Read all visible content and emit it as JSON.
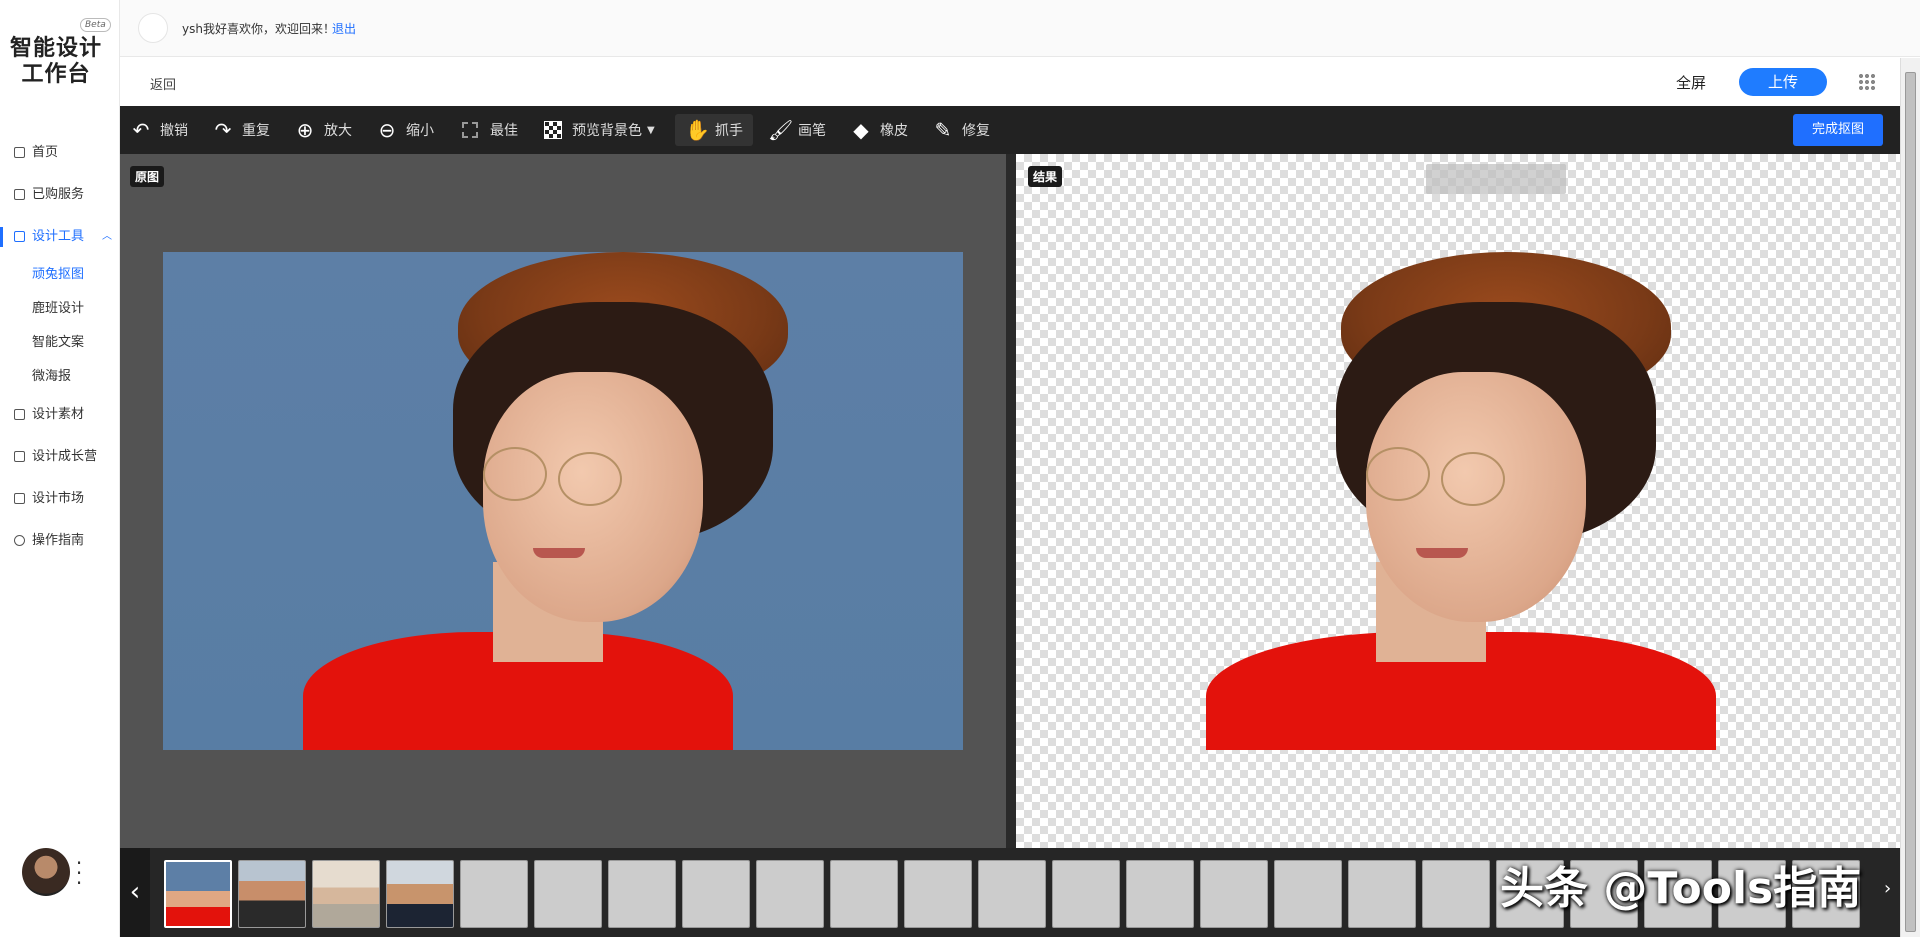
{
  "logo": {
    "badge": "Beta",
    "line1": "智能设计",
    "line2": "工作台"
  },
  "sidebar": {
    "items": [
      {
        "label": "首页"
      },
      {
        "label": "已购服务"
      },
      {
        "label": "设计工具"
      },
      {
        "label": "顽兔抠图"
      },
      {
        "label": "鹿班设计"
      },
      {
        "label": "智能文案"
      },
      {
        "label": "微海报"
      },
      {
        "label": "设计素材"
      },
      {
        "label": "设计成长营"
      },
      {
        "label": "设计市场"
      },
      {
        "label": "操作指南"
      }
    ]
  },
  "topbar": {
    "welcome": "ysh我好喜欢你，欢迎回来！",
    "logout": "退出"
  },
  "header": {
    "back": "返回",
    "fullscreen": "全屏",
    "upload": "上传"
  },
  "toolbar": {
    "undo": "撤销",
    "redo": "重复",
    "zoom_in": "放大",
    "zoom_out": "缩小",
    "best_fit": "最佳",
    "preview_bg": "预览背景色",
    "hand": "抓手",
    "brush": "画笔",
    "eraser": "橡皮",
    "repair": "修复",
    "done": "完成抠图"
  },
  "panels": {
    "original": "原图",
    "result": "结果"
  },
  "watermark": "头条 @Tools指南",
  "colors": {
    "accent": "#1f6fff",
    "toolbar_bg": "#222222",
    "shirt": "#e3120c"
  }
}
